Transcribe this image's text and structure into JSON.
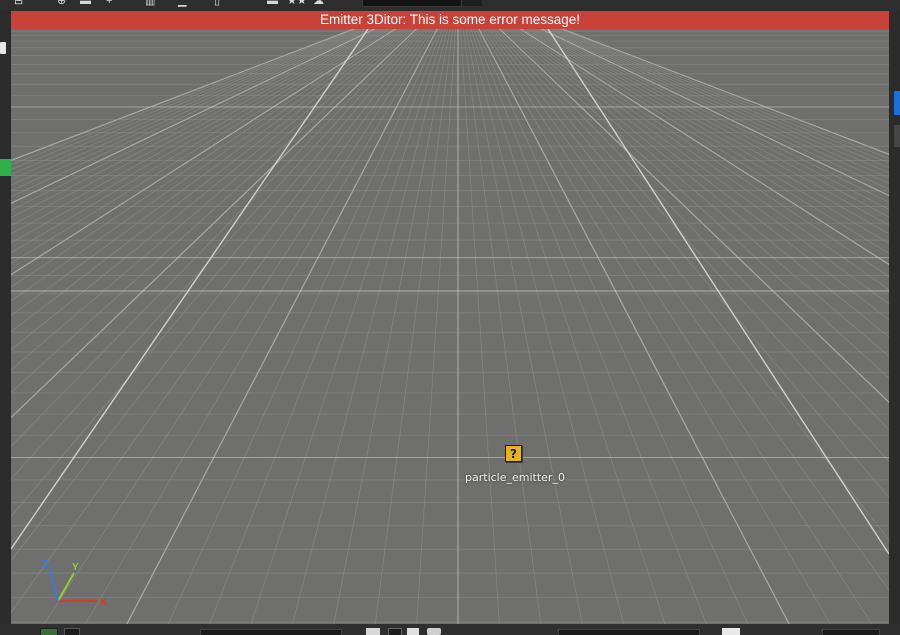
{
  "error": {
    "message": "Emitter 3Ditor: This is some error message!",
    "color": "#c8423a"
  },
  "toolbar": {
    "icons": [
      "layout-icon",
      "globe-icon",
      "frame-icon",
      "add-icon",
      "grid-icon",
      "bar-icon",
      "document-icon",
      "window-icon",
      "star-icon",
      "sky-icon"
    ]
  },
  "viewport": {
    "background": "#6f706d",
    "emitter": {
      "icon_glyph": "?",
      "label": "particle_emitter_0"
    },
    "gizmo": {
      "x_label": "X",
      "y_label": "Y",
      "z_label": "Z",
      "x_color": "#d23a2a",
      "y_color": "#8ed12c",
      "z_color": "#3a78e0"
    }
  },
  "left_rail": {
    "accent": "#2fb14a"
  },
  "right_rail": {
    "accent": "#1c6fd6"
  },
  "bottom_bar": {
    "icons": [
      "select-icon",
      "refresh-icon",
      "delete-icon",
      "dropdown-icon",
      "bold-icon",
      "shape-icon",
      "close-icon"
    ]
  }
}
